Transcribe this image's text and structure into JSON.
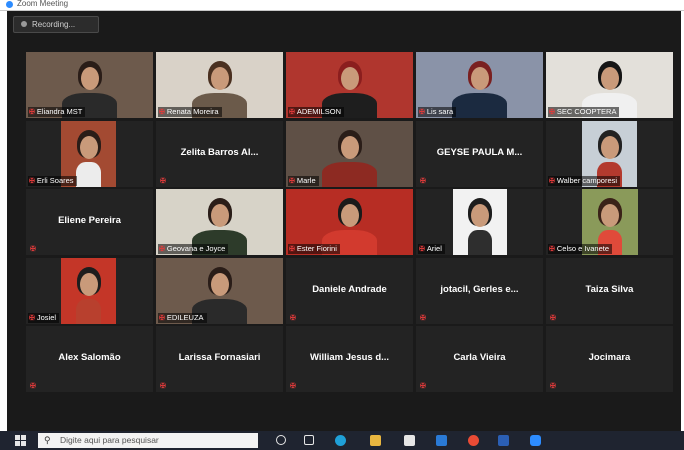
{
  "window": {
    "title": "Zoom Meeting"
  },
  "recording": {
    "label": "Recording..."
  },
  "participants": [
    {
      "name": "Eliandra MST",
      "video": true
    },
    {
      "name": "Renata Moreira",
      "video": true
    },
    {
      "name": "ADEMILSON",
      "video": true,
      "active": true
    },
    {
      "name": "Lis  sara",
      "video": true
    },
    {
      "name": "SEC COOPTERA",
      "video": true
    },
    {
      "name": "Erli Soares",
      "video": true
    },
    {
      "name": "Zelita Barros Al...",
      "video": false
    },
    {
      "name": "Marle",
      "video": true
    },
    {
      "name": "GEYSE PAULA M...",
      "video": false
    },
    {
      "name": "Walber camporesi",
      "video": true
    },
    {
      "name": "Eliene Pereira",
      "video": false
    },
    {
      "name": "Geovana e Joyce",
      "video": true
    },
    {
      "name": "Ester Fiorini",
      "video": true
    },
    {
      "name": "Ariel",
      "video": true
    },
    {
      "name": "Celso e Ivanete",
      "video": true
    },
    {
      "name": "Josiel",
      "video": true
    },
    {
      "name": "EDILEUZA",
      "video": true
    },
    {
      "name": "Daniele Andrade",
      "video": false
    },
    {
      "name": "jotacil, Gerles e...",
      "video": false
    },
    {
      "name": "Taiza Silva",
      "video": false
    },
    {
      "name": "Alex Salomão",
      "video": false
    },
    {
      "name": "Larissa Fornasiari",
      "video": false
    },
    {
      "name": "William  Jesus d...",
      "video": false
    },
    {
      "name": "Carla Vieira",
      "video": false
    },
    {
      "name": "Jocimara",
      "video": false
    }
  ],
  "taskbar": {
    "search_placeholder": "Digite aqui para pesquisar",
    "icons": [
      "windows-start-icon",
      "search-icon",
      "cortana-icon",
      "task-view-icon",
      "edge-icon",
      "file-explorer-icon",
      "store-icon",
      "mail-icon",
      "chrome-icon",
      "word-icon",
      "zoom-icon"
    ]
  },
  "colors": {
    "active_speaker": "#d8d84a",
    "muted_mic": "#e23b3b",
    "taskbar": "#1f2430"
  }
}
